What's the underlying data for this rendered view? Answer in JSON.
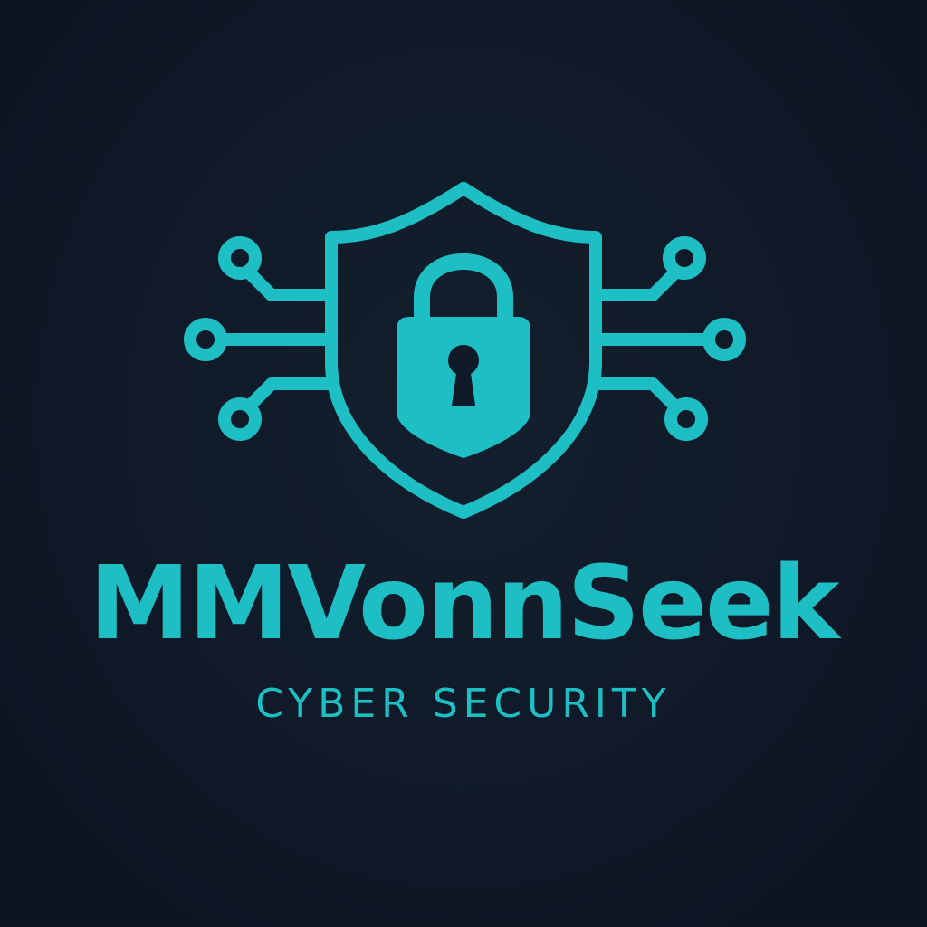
{
  "brand": {
    "name": "MMVonnSeek",
    "tagline": "CYBER SECURITY"
  },
  "emblem": {
    "icons": [
      "shield-icon",
      "padlock-icon",
      "keyhole-icon",
      "circuit-traces-icon"
    ]
  },
  "colors": {
    "background": "#0f1927",
    "accent": "#1ebfc4",
    "cutout": "#0f1927"
  }
}
